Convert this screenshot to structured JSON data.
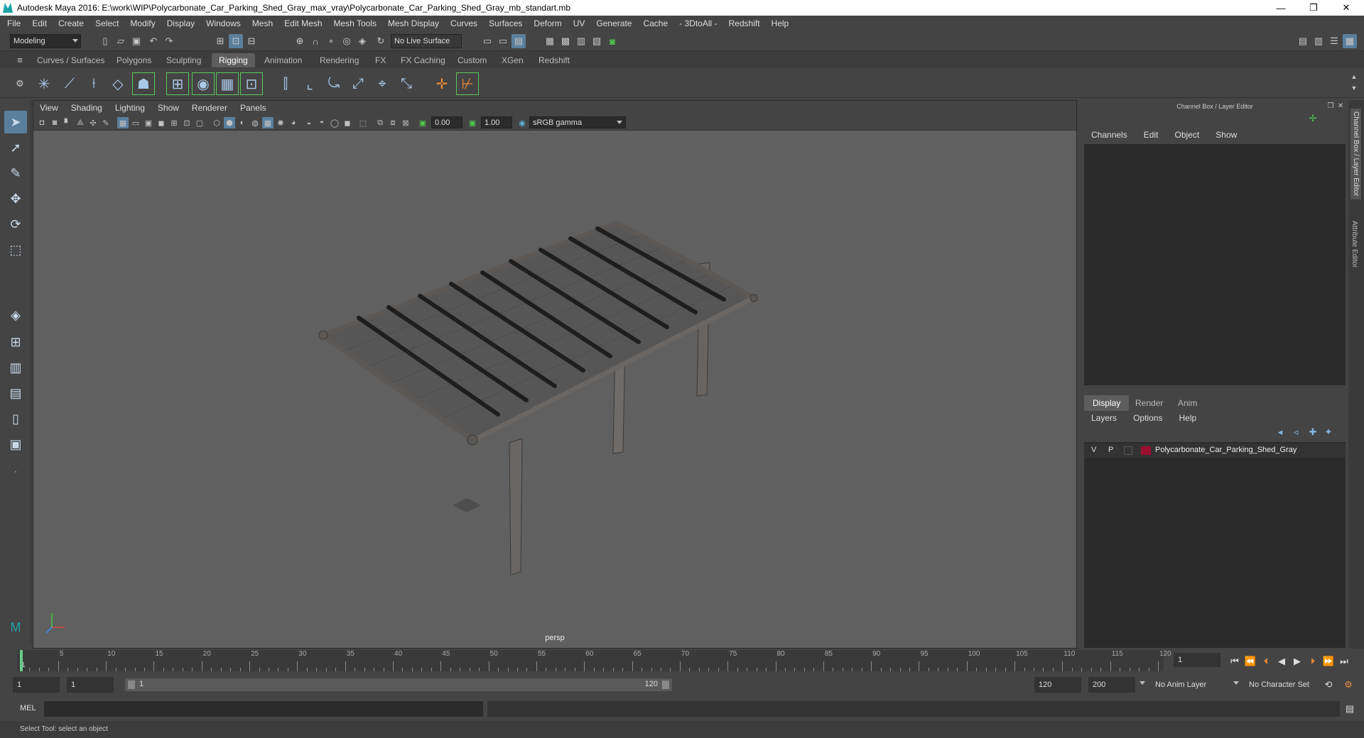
{
  "window": {
    "title": "Autodesk Maya 2016: E:\\work\\WIP\\Polycarbonate_Car_Parking_Shed_Gray_max_vray\\Polycarbonate_Car_Parking_Shed_Gray_mb_standart.mb",
    "minimize": "—",
    "restore": "❐",
    "close": "✕"
  },
  "menubar": [
    "File",
    "Edit",
    "Create",
    "Select",
    "Modify",
    "Display",
    "Windows",
    "Mesh",
    "Edit Mesh",
    "Mesh Tools",
    "Mesh Display",
    "Curves",
    "Surfaces",
    "Deform",
    "UV",
    "Generate",
    "Cache",
    "- 3DtoAll -",
    "Redshift",
    "Help"
  ],
  "statusline": {
    "mode": "Modeling",
    "live_surface": "No Live Surface"
  },
  "shelf_tabs": [
    "Curves / Surfaces",
    "Polygons",
    "Sculpting",
    "Rigging",
    "Animation",
    "Rendering",
    "FX",
    "FX Caching",
    "Custom",
    "XGen",
    "Redshift"
  ],
  "active_shelf_tab": "Rigging",
  "viewport": {
    "menu": [
      "View",
      "Shading",
      "Lighting",
      "Show",
      "Renderer",
      "Panels"
    ],
    "exposure": "0.00",
    "gamma": "1.00",
    "color_space": "sRGB gamma",
    "camera_label": "persp"
  },
  "channel_box": {
    "title": "Channel Box / Layer Editor",
    "menu": [
      "Channels",
      "Edit",
      "Object",
      "Show"
    ],
    "side_tabs": [
      "Channel Box / Layer Editor",
      "Attribute Editor"
    ]
  },
  "layer_editor": {
    "tabs": [
      "Display",
      "Render",
      "Anim"
    ],
    "active_tab": "Display",
    "menu": [
      "Layers",
      "Options",
      "Help"
    ],
    "layers": [
      {
        "v": "V",
        "p": "P",
        "name": "Polycarbonate_Car_Parking_Shed_Gray",
        "color": "#9b1030"
      }
    ]
  },
  "timeline": {
    "labels": [
      "1",
      "5",
      "10",
      "15",
      "20",
      "25",
      "30",
      "35",
      "40",
      "45",
      "50",
      "55",
      "60",
      "65",
      "70",
      "75",
      "80",
      "85",
      "90",
      "95",
      "100",
      "105",
      "110",
      "115",
      "120"
    ],
    "current_frame": "1"
  },
  "range": {
    "start": "1",
    "playback_start": "1",
    "slider_start": "1",
    "slider_end": "120",
    "playback_end": "120",
    "end": "200",
    "anim_layer": "No Anim Layer",
    "character_set": "No Character Set"
  },
  "cmdline": {
    "label": "MEL"
  },
  "helpline": {
    "text": "Select Tool: select an object"
  }
}
